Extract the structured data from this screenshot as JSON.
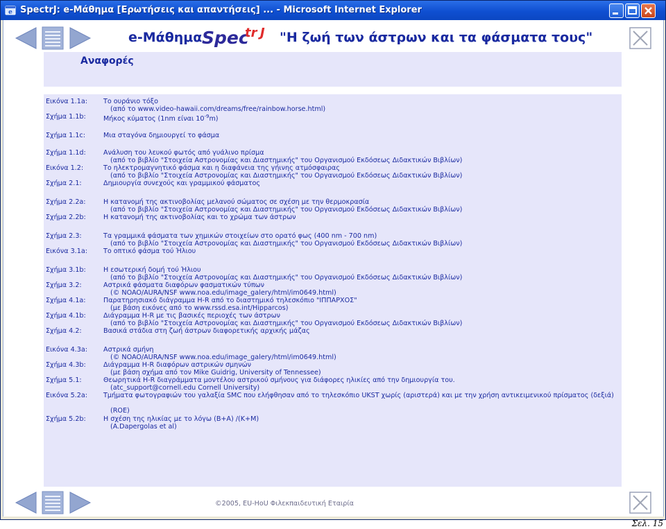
{
  "window": {
    "title": "SpectrJ: e-Μάθημα [Ερωτήσεις και απαντήσεις] ... - Microsoft Internet Explorer"
  },
  "header": {
    "course": "e-Μάθημα",
    "logo_text": "Spectr",
    "logo_suffix": "J",
    "subtitle": "\"Η ζωή των άστρων και τα φάσματα τους\""
  },
  "section": {
    "title": "Αναφορές"
  },
  "references": [
    {
      "label": "Εικόνα 1.1a:",
      "text": "Το ουράνιο τόξο",
      "sub": "(από το www.video-hawaii.com/dreams/free/rainbow.horse.html)"
    },
    {
      "label": "Σχήμα 1.1b:",
      "text": "Μήκος κύματος (1nm είναι 10",
      "sup": "-9",
      "text_end": "m)"
    },
    {
      "label": "Σχήμα 1.1c:",
      "text": "Μια σταγόνα δημιουργεί το φάσμα"
    },
    {
      "label": "Σχήμα 1.1d:",
      "text": "Ανάλυση του λευκού φωτός από γυάλινο πρίσμα",
      "sub": "(από το βιβλίο \"Στοιχεία Αστρονομίας και Διαστημικής\" του Οργανισμού Εκδόσεως Διδακτικών Βιβλίων)"
    },
    {
      "label": "Εικόνα 1.2:",
      "text": "Το ηλεκτρομαγνητικό φάσμα και η διαφάνεια της γήινης ατμόσφαιρας",
      "sub": "(από το βιβλίο \"Στοιχεία Αστρονομίας και Διαστημικής\" του Οργανισμού Εκδόσεως Διδακτικών Βιβλίων)"
    },
    {
      "label": "Σχήμα 2.1:",
      "text": "Δημιουργία συνεχούς και γραμμικού φάσματος"
    },
    {
      "label": "Σχήμα 2.2a:",
      "text": "Η κατανομή της ακτινοβολίας μελανού σώματος σε σχέση με την θερμοκρασία",
      "sub": "(από το βιβλίο \"Στοιχεία Αστρονομίας και Διαστημικής\" του Οργανισμού Εκδόσεως Διδακτικών Βιβλίων)"
    },
    {
      "label": "Σχήμα 2.2b:",
      "text": "Η κατανομή της ακτινοβολίας και το χρώμα των άστρων"
    },
    {
      "label": "Σχήμα 2.3:",
      "text": "Τα γραμμικά φάσματα των χημικών στοιχείων στο ορατό φως (400 nm - 700 nm)",
      "sub": "(από το βιβλίο \"Στοιχεία Αστρονομίας και Διαστημικής\" του Οργανισμού Εκδόσεως Διδακτικών Βιβλίων)"
    },
    {
      "label": "Εικόνα 3.1a:",
      "text": "Το οπτικό φάσμα τού Ήλιου"
    },
    {
      "label": "Σχήμα 3.1b:",
      "text": "Η εσωτερική δομή τού Ήλιου",
      "sub": "(από το βιβλίο \"Στοιχεία Αστρονομίας και Διαστημικής\" του Οργανισμού Εκδόσεως Διδακτικών Βιβλίων)"
    },
    {
      "label": "Σχήμα 3.2:",
      "text": "Αστρικά φάσματα διαφόρων φασματικών τύπων",
      "sub": "(© NOAO/AURA/NSF www.noa.edu/image_galery/html/im0649.html)"
    },
    {
      "label": "Σχήμα 4.1a:",
      "text": "Παρατηρησιακό διάγραμμα H-R από το διαστημικό τηλεσκόπιο \"ΙΠΠΑΡΧΟΣ\"",
      "sub": "(με βάση εικόνες από το www.rssd.esa.int/Hipparcos)"
    },
    {
      "label": "Σχήμα 4.1b:",
      "text": "Διάγραμμα H-R με τις βασικές περιοχές των άστρων",
      "sub": "(από το βιβλίο \"Στοιχεία Αστρονομίας και Διαστημικής\" του Οργανισμού Εκδόσεως Διδακτικών Βιβλίων)"
    },
    {
      "label": "Σχήμα 4.2:",
      "text": "Βασικά στάδια στη ζωή άστρων διαφορετικής αρχικής μάζας"
    },
    {
      "label": "Εικόνα 4.3a:",
      "text": "Αστρικά σμήνη",
      "sub": "(© NOAO/AURA/NSF www.noa.edu/image_galery/html/im0649.html)"
    },
    {
      "label": "Σχήμα 4.3b:",
      "text": "Διάγραμμα H-R διαφόρων αστρικών σμηνών",
      "sub": "(με βάση σχήμα από τον Mike Guidrig, University of Tennessee)"
    },
    {
      "label": "Σχήμα 5.1:",
      "text": "Θεωρητικά H-R διαγράμματα μοντέλου αστρικού σμήνους για διάφορες ηλικίες από την δημιουργία του.",
      "sub": "(atc_support@cornell.edu Cornell University)"
    },
    {
      "label": "Εικόνα 5.2a:",
      "text": "Τμήματα φωτογραφιών του γαλαξία SMC που ελήφθησαν από το τηλεσκόπιο UKST χωρίς (αριστερά) και με την χρήση αντικειμενικού πρίσματος (δεξιά)",
      "sub": "(ROE)"
    },
    {
      "label": "Σχήμα 5.2b:",
      "text": "Η σχέση της ηλικίας με το λόγω (B+A) /(K+M)",
      "sub": "(A.Dapergolas et al)"
    }
  ],
  "footer": {
    "copyright": "©2005, EU-HoU Φιλεκπαιδευτική Εταιρία"
  },
  "page_number": "Σελ. 15",
  "colors": {
    "accent": "#1a2aa0",
    "panel": "#e6e6fa",
    "nav_button": "#8ca0cd",
    "title_bar": "#0f4fd1"
  }
}
